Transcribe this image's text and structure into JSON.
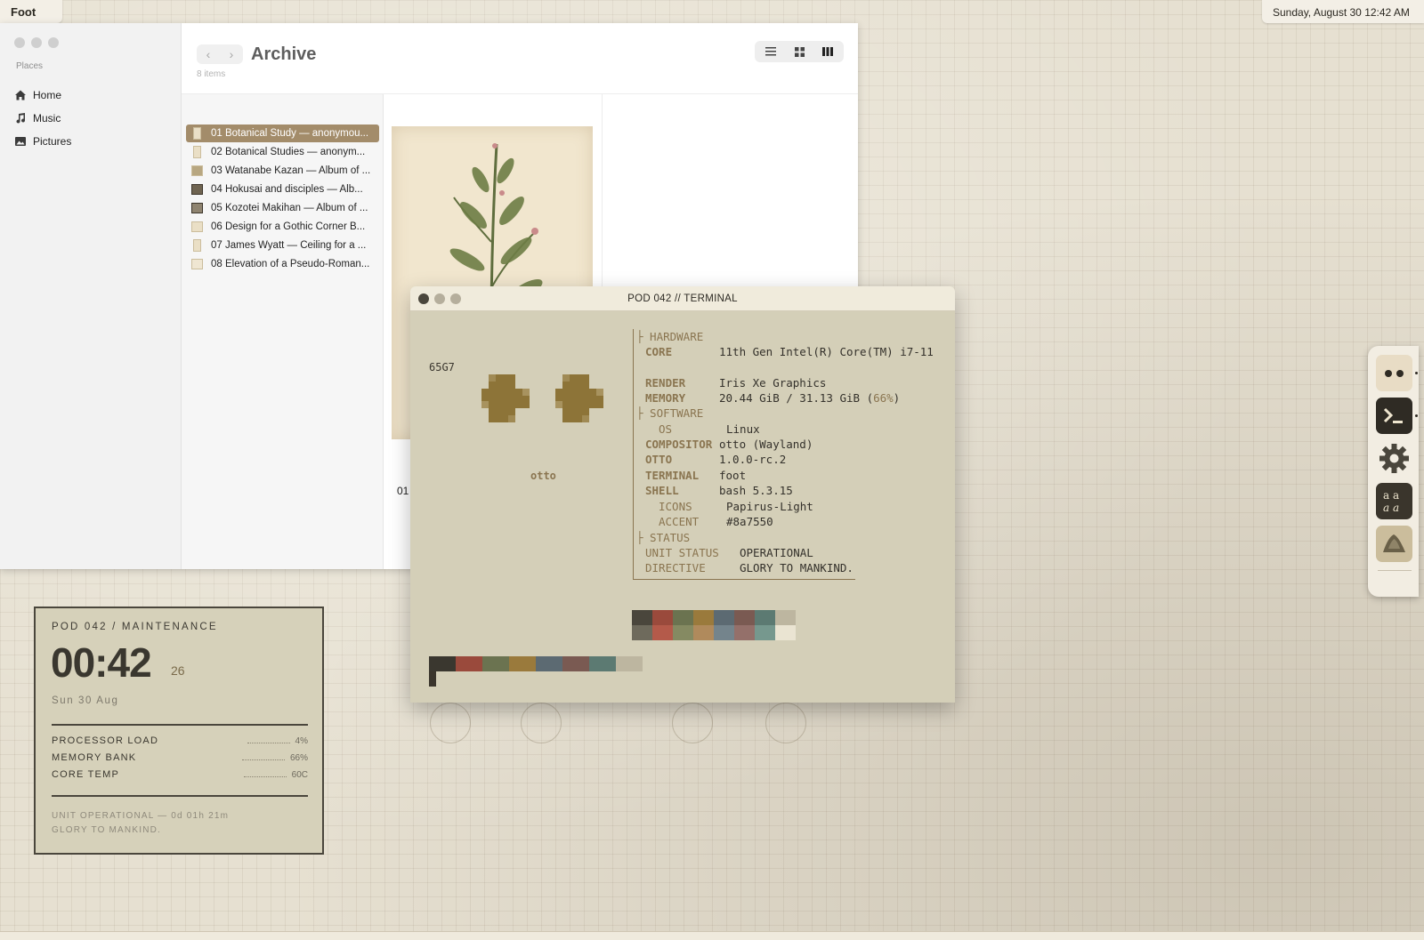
{
  "topbar": {
    "app_name": "Foot",
    "datetime": "Sunday, August 30 12:42 AM"
  },
  "file_manager": {
    "sidebar": {
      "section_title": "Places",
      "items": [
        {
          "label": "Home",
          "icon": "home-icon"
        },
        {
          "label": "Music",
          "icon": "music-icon"
        },
        {
          "label": "Pictures",
          "icon": "pictures-icon"
        }
      ]
    },
    "nav": {
      "back": "‹",
      "forward": "›"
    },
    "title": "Archive",
    "item_count": "8 items",
    "view_modes": [
      "list-view-icon",
      "grid-view-icon",
      "column-view-icon"
    ],
    "files": [
      {
        "name": "01 Botanical Study — anonymou...",
        "selected": true
      },
      {
        "name": "02 Botanical Studies — anonym..."
      },
      {
        "name": "03 Watanabe Kazan — Album of ..."
      },
      {
        "name": "04 Hokusai and disciples — Alb..."
      },
      {
        "name": "05 Kozotei Makihan — Album of ..."
      },
      {
        "name": "06 Design for a Gothic Corner B..."
      },
      {
        "name": "07 James Wyatt — Ceiling for a ..."
      },
      {
        "name": "08 Elevation of a Pseudo-Roman..."
      }
    ],
    "preview_label": "01"
  },
  "terminal": {
    "title": "POD 042 // TERMINAL",
    "unit_id": "65G7",
    "user": "otto",
    "sections": {
      "hardware": "├ HARDWARE",
      "software": "├ SOFTWARE",
      "status": "├ STATUS"
    },
    "hardware": [
      {
        "key": "CORE",
        "value": "11th Gen Intel(R) Core(TM) i7-11"
      },
      {
        "key": "RENDER",
        "value": "Iris Xe Graphics"
      },
      {
        "key": "MEMORY",
        "value_main": "20.44 GiB / 31.13 GiB (",
        "value_pct": "66%",
        "value_end": ")"
      }
    ],
    "software": [
      {
        "key": "OS",
        "value": "Linux"
      },
      {
        "key": "COMPOSITOR",
        "value": "otto (Wayland)"
      },
      {
        "key": "OTTO",
        "value": "1.0.0-rc.2"
      },
      {
        "key": "TERMINAL",
        "value": "foot"
      },
      {
        "key": "SHELL",
        "value": "bash 5.3.15"
      },
      {
        "key": "ICONS",
        "value": "Papirus-Light"
      },
      {
        "key": "ACCENT",
        "value": "#8a7550"
      }
    ],
    "status": [
      {
        "key": "UNIT STATUS",
        "value": "OPERATIONAL"
      },
      {
        "key": "DIRECTIVE",
        "value": "GLORY TO MANKIND."
      }
    ],
    "palette_top": [
      "#4a463c",
      "#9a4a3c",
      "#6b7350",
      "#9a7a3c",
      "#5c6a72",
      "#7a5a52",
      "#5c7a72",
      "#bdb6a0"
    ],
    "palette_bottom": [
      "#6e6a5c",
      "#b45a4a",
      "#858a62",
      "#b08a5c",
      "#74848c",
      "#94706a",
      "#76988e",
      "#eae4d2"
    ],
    "bar_palette": [
      "#3a372f",
      "#9a4a3c",
      "#6b7350",
      "#9a7a3c",
      "#5c6a72",
      "#7a5a52",
      "#5c7a72",
      "#bdb6a0"
    ]
  },
  "widget": {
    "title": "POD 042 / MAINTENANCE",
    "time": "00:42",
    "seconds": "26",
    "date": "Sun 30 Aug",
    "stats": [
      {
        "label": "PROCESSOR LOAD",
        "value": "4%"
      },
      {
        "label": "MEMORY BANK",
        "value": "66%"
      },
      {
        "label": "CORE TEMP",
        "value": "60C"
      }
    ],
    "footer_line1": "UNIT OPERATIONAL — 0d 01h 21m",
    "footer_line2": "GLORY TO MANKIND."
  },
  "dock": {
    "items": [
      "otto-eyes-icon",
      "terminal-icon",
      "settings-gear-icon",
      "font-viewer-icon",
      "image-viewer-icon"
    ]
  },
  "colors": {
    "accent": "#8a7550",
    "selection": "#a38c6a",
    "terminal_bg": "#d4cfb8",
    "widget_bg": "#d6d1ba"
  }
}
